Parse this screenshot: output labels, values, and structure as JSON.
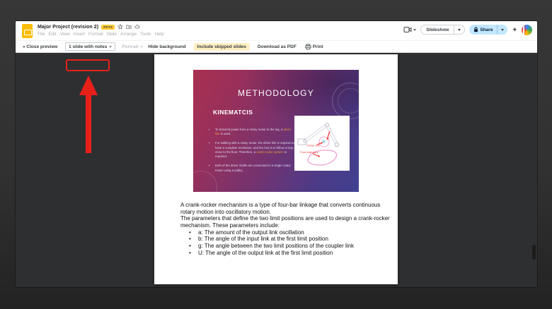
{
  "header": {
    "title": "Major Project (revision 2)",
    "badge": "PPTX",
    "menus": [
      "File",
      "Edit",
      "View",
      "Insert",
      "Format",
      "Slide",
      "Arrange",
      "Tools",
      "Help"
    ],
    "slideshow_label": "Slideshow",
    "share_label": "Share"
  },
  "toolbar": {
    "close_preview": "« Close preview",
    "layout_dropdown": "1 slide with notes",
    "orientation": "Portrait",
    "hide_background": "Hide background",
    "include_skipped": "Include skipped slides",
    "download_pdf": "Download as PDF",
    "print": "Print"
  },
  "slide": {
    "title": "METHODOLOGY",
    "heading": "KINEMATCIS",
    "bullets": [
      {
        "pre": "To transmit power from a rotary motor to the leg, a ",
        "hl": "driver link",
        "post": " is used."
      },
      {
        "pre": "For walking with a rotary motor, the driver link is required to have a complete revolution, and the foot is to follow a loop close to the floor. Therefore, a ",
        "hl": "crank rocker system",
        "post": " is required."
      },
      {
        "pre": "Both of the driver shafts are connected to a single rotary motor using a pulley.",
        "hl": "",
        "post": ""
      }
    ],
    "diagram_labels": {
      "driver_link": "Driver link",
      "foot_trajectory": "Foot trajectory"
    }
  },
  "notes": {
    "para1": "A crank-rocker mechanism is a type of four-bar linkage that converts continuous rotary motion into oscillatory motion.",
    "para2": "The parameters that define the two limit positions are used to design a crank-rocker mechanism. These parameters include:",
    "bullets": [
      "a: The amount of the output link oscillation",
      "b: The angle of the input link at the first limit position",
      "g: The angle between the two limit positions of the coupler link",
      "U: The angle of the output link at the first limit position"
    ]
  },
  "colors": {
    "annotation_red": "#e8201a",
    "share_bg": "#c2e7ff",
    "chip_bg": "#feefc3",
    "badge_bg": "#fbc934",
    "preview_bg": "#2e2f30",
    "slide_gradient_start": "#a93050",
    "slide_gradient_end": "#3f4190",
    "highlight_orange": "#e6a23c"
  }
}
